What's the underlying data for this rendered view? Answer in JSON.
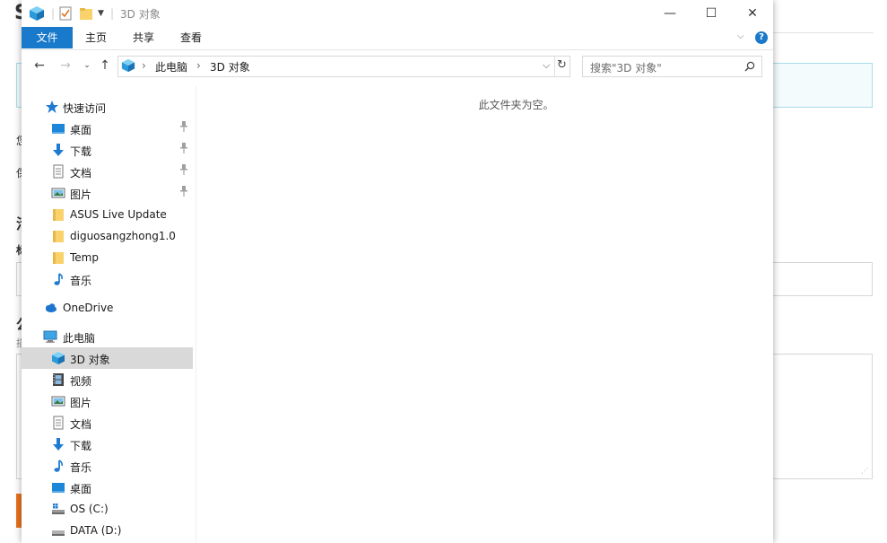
{
  "window": {
    "title": "3D 对象",
    "ribbon_tabs": [
      "文件",
      "主页",
      "共享",
      "查看"
    ],
    "minimize_label": "—",
    "maximize_label": "☐",
    "close_label": "✕"
  },
  "address": {
    "segments": [
      "此电脑",
      "3D 对象"
    ]
  },
  "search": {
    "placeholder": "搜索\"3D 对象\""
  },
  "nav": {
    "quick_access": "快速访问",
    "quick_items": [
      {
        "label": "桌面",
        "icon": "desktop-icon",
        "pinned": true
      },
      {
        "label": "下载",
        "icon": "download-icon",
        "pinned": true
      },
      {
        "label": "文档",
        "icon": "document-icon",
        "pinned": true
      },
      {
        "label": "图片",
        "icon": "picture-icon",
        "pinned": true
      },
      {
        "label": "ASUS Live Update",
        "icon": "folder-icon",
        "pinned": false
      },
      {
        "label": "diguosangzhong1.0",
        "icon": "folder-icon",
        "pinned": false
      },
      {
        "label": "Temp",
        "icon": "folder-icon",
        "pinned": false
      },
      {
        "label": "音乐",
        "icon": "music-icon",
        "pinned": false
      }
    ],
    "onedrive": "OneDrive",
    "this_pc": "此电脑",
    "pc_items": [
      {
        "label": "3D 对象",
        "icon": "3d-objects-icon",
        "selected": true
      },
      {
        "label": "视频",
        "icon": "video-icon"
      },
      {
        "label": "图片",
        "icon": "picture-icon"
      },
      {
        "label": "文档",
        "icon": "document-icon"
      },
      {
        "label": "下载",
        "icon": "download-icon"
      },
      {
        "label": "音乐",
        "icon": "music-icon"
      },
      {
        "label": "桌面",
        "icon": "desktop-icon"
      },
      {
        "label": "OS (C:)",
        "icon": "drive-c-icon"
      },
      {
        "label": "DATA (D:)",
        "icon": "drive-d-icon"
      }
    ]
  },
  "content": {
    "empty_text": "此文件夹为空。"
  },
  "colors": {
    "accent": "#1979ca",
    "selection": "#d9d9d9"
  }
}
